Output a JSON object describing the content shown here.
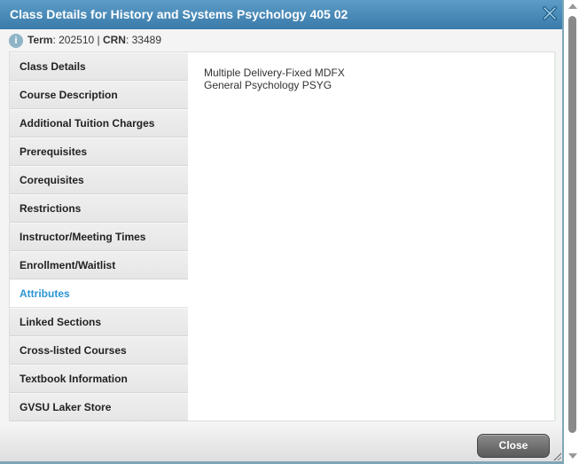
{
  "dialog": {
    "title": "Class Details for History and Systems Psychology 405 02",
    "close_icon": "close-x-icon"
  },
  "info": {
    "icon": "info-icon",
    "icon_glyph": "i",
    "term_label": "Term",
    "term_value": ": 202510 | ",
    "crn_label": "CRN",
    "crn_value": ": 33489"
  },
  "nav": {
    "items": [
      {
        "label": "Class Details",
        "active": false
      },
      {
        "label": "Course Description",
        "active": false
      },
      {
        "label": "Additional Tuition Charges",
        "active": false
      },
      {
        "label": "Prerequisites",
        "active": false
      },
      {
        "label": "Corequisites",
        "active": false
      },
      {
        "label": "Restrictions",
        "active": false
      },
      {
        "label": "Instructor/Meeting Times",
        "active": false
      },
      {
        "label": "Enrollment/Waitlist",
        "active": false
      },
      {
        "label": "Attributes",
        "active": true
      },
      {
        "label": "Linked Sections",
        "active": false
      },
      {
        "label": "Cross-listed Courses",
        "active": false
      },
      {
        "label": "Textbook Information",
        "active": false
      },
      {
        "label": "GVSU Laker Store",
        "active": false
      }
    ]
  },
  "content": {
    "lines": [
      "Multiple Delivery-Fixed MDFX",
      "General Psychology PSYG"
    ]
  },
  "footer": {
    "close_label": "Close"
  },
  "colors": {
    "titlebar": "#3a7bab",
    "active_tab": "#2a95d3",
    "button": "#5a5a5a"
  }
}
